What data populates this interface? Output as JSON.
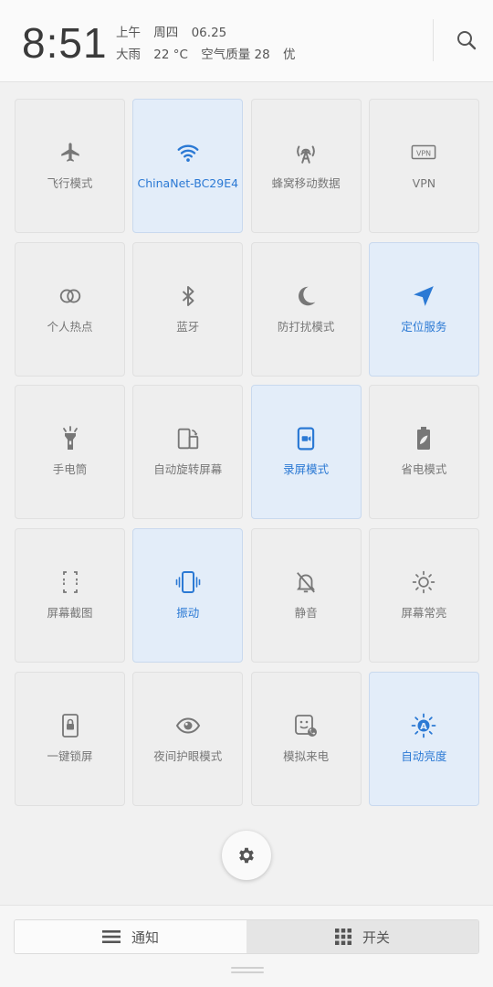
{
  "header": {
    "time": "8:51",
    "period": "上午",
    "weekday": "周四",
    "date": "06.25",
    "weather": "大雨",
    "temperature": "22 °C",
    "air_quality_label": "空气质量 28",
    "air_quality_level": "优"
  },
  "tiles": [
    {
      "label": "飞行模式",
      "icon": "airplane-icon",
      "active": false
    },
    {
      "label": "ChinaNet-BC29E4",
      "icon": "wifi-icon",
      "active": true
    },
    {
      "label": "蜂窝移动数据",
      "icon": "cellular-icon",
      "active": false
    },
    {
      "label": "VPN",
      "icon": "vpn-icon",
      "active": false
    },
    {
      "label": "个人热点",
      "icon": "hotspot-icon",
      "active": false
    },
    {
      "label": "蓝牙",
      "icon": "bluetooth-icon",
      "active": false
    },
    {
      "label": "防打扰模式",
      "icon": "moon-icon",
      "active": false
    },
    {
      "label": "定位服务",
      "icon": "location-icon",
      "active": true
    },
    {
      "label": "手电筒",
      "icon": "flashlight-icon",
      "active": false
    },
    {
      "label": "自动旋转屏幕",
      "icon": "rotate-icon",
      "active": false
    },
    {
      "label": "录屏模式",
      "icon": "screen-record-icon",
      "active": true
    },
    {
      "label": "省电模式",
      "icon": "battery-saver-icon",
      "active": false
    },
    {
      "label": "屏幕截图",
      "icon": "screenshot-icon",
      "active": false
    },
    {
      "label": "振动",
      "icon": "vibrate-icon",
      "active": true
    },
    {
      "label": "静音",
      "icon": "mute-icon",
      "active": false
    },
    {
      "label": "屏幕常亮",
      "icon": "brightness-icon",
      "active": false
    },
    {
      "label": "一键锁屏",
      "icon": "lock-icon",
      "active": false
    },
    {
      "label": "夜间护眼模式",
      "icon": "eye-icon",
      "active": false
    },
    {
      "label": "模拟来电",
      "icon": "fake-call-icon",
      "active": false
    },
    {
      "label": "自动亮度",
      "icon": "auto-brightness-icon",
      "active": true
    }
  ],
  "bottom": {
    "tab_notifications": "通知",
    "tab_toggles": "开关",
    "selected_tab": "开关"
  },
  "colors": {
    "active": "#2b79d4",
    "inactive": "#777777",
    "active_bg": "#e3edf9"
  }
}
